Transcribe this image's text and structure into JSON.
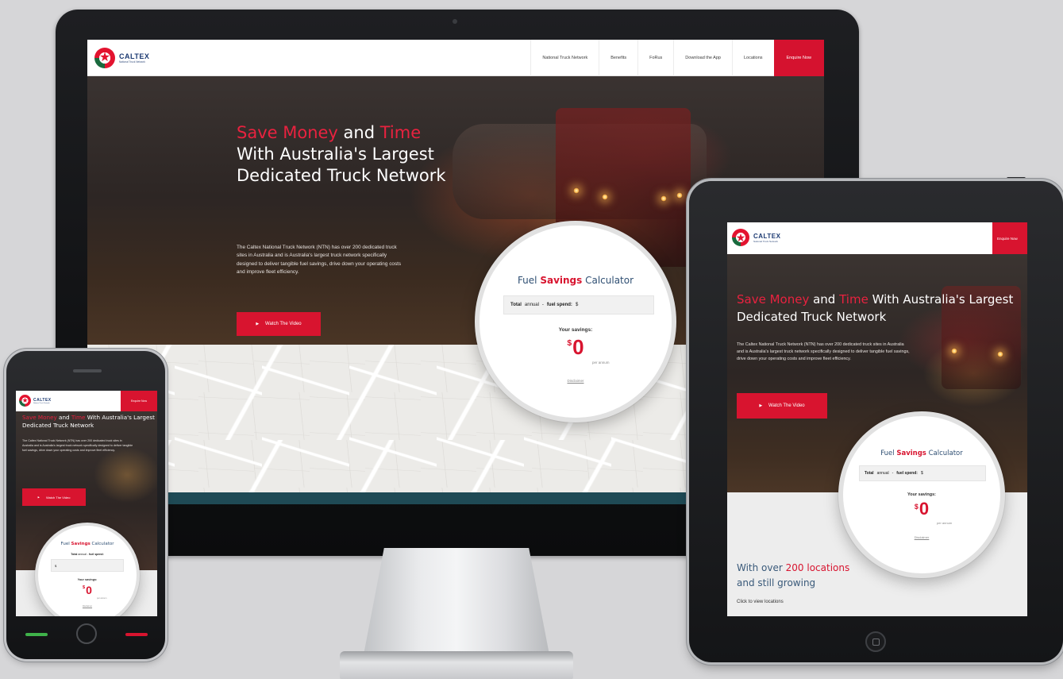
{
  "brand": {
    "name": "CALTEX",
    "subtitle": "National Truck Network",
    "red": "#d8142f",
    "navy": "#1c3a72"
  },
  "nav": {
    "items": [
      "National Truck Network",
      "Benefits",
      "FoRus",
      "Download the App",
      "Locations"
    ],
    "cta": "Enquire Now"
  },
  "hero": {
    "title_hl1": "Save Money",
    "title_and": " and ",
    "title_hl2": "Time",
    "title_rest": "With Australia's Largest Dedicated Truck Network",
    "title_rest_tablet": " With Australia's Largest Dedicated Truck Network",
    "body": "The Caltex National Truck Network (NTN) has over 200 dedicated truck sites in Australia and is Australia's largest truck network specifically designed to deliver tangible fuel savings, drive down your operating costs and improve fleet efficiency.",
    "cta": "Watch The Video"
  },
  "calculator": {
    "title_pre": "Fuel ",
    "title_hl": "Savings",
    "title_post": " Calculator",
    "input_label1": "Total",
    "input_unit": "annual",
    "input_sep": "-",
    "input_label2": "fuel spend:",
    "input_value": "$",
    "savings_label": "Your savings:",
    "currency": "$",
    "amount": "0",
    "period": "per annum",
    "disclaimer": "Disclaimer"
  },
  "locations": {
    "line1_pre": "With over ",
    "line1_hl": "200 locations",
    "line2": "and still growing",
    "link": "Click to view locations"
  },
  "icons": {
    "logo": "caltex-star-icon",
    "play": "play-icon"
  }
}
